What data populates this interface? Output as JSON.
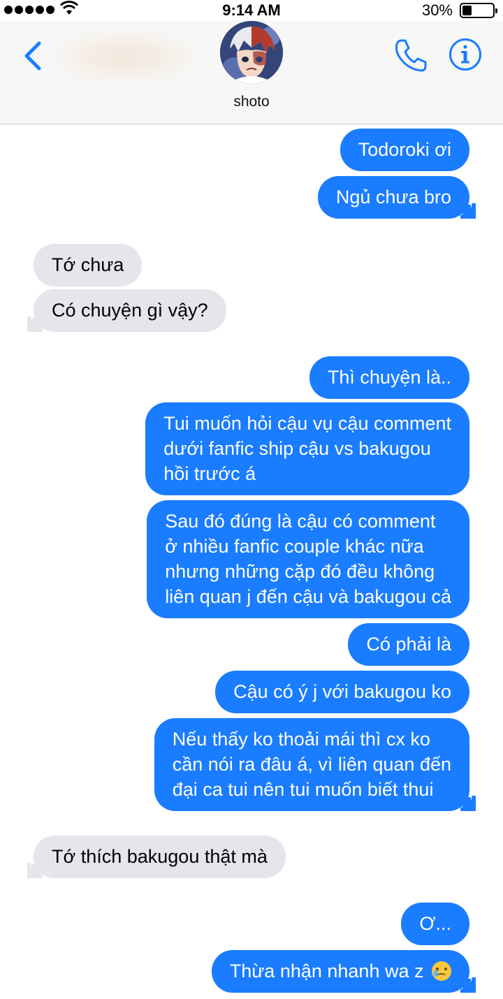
{
  "status_bar": {
    "time": "9:14 AM",
    "battery_percent": "30%",
    "battery_level": 0.3,
    "icons": [
      "signal-dots-icon",
      "wifi-icon",
      "battery-icon"
    ]
  },
  "header": {
    "contact_name": "shoto",
    "icons": [
      "back-chevron-icon",
      "phone-icon",
      "info-icon"
    ],
    "accent_color": "#1a7cff"
  },
  "messages": [
    {
      "direction": "outgoing",
      "lines": [
        "Todoroki ơi"
      ]
    },
    {
      "direction": "outgoing",
      "lines": [
        "Ngủ chưa bro"
      ]
    },
    {
      "direction": "incoming",
      "lines": [
        "Tớ chưa"
      ]
    },
    {
      "direction": "incoming",
      "lines": [
        "Có chuyện gì vậy?"
      ]
    },
    {
      "direction": "outgoing",
      "lines": [
        "Thì chuyện là.."
      ]
    },
    {
      "direction": "outgoing",
      "lines": [
        "Tui muốn hỏi cậu vụ cậu comment",
        "dưới fanfic ship cậu vs bakugou",
        "hồi trước á"
      ]
    },
    {
      "direction": "outgoing",
      "lines": [
        "Sau đó đúng là cậu có comment",
        "ở nhiều fanfic couple khác nữa",
        "nhưng những cặp đó đều không",
        "liên quan j đến cậu và bakugou cả"
      ]
    },
    {
      "direction": "outgoing",
      "lines": [
        "Có phải là"
      ]
    },
    {
      "direction": "outgoing",
      "lines": [
        "Cậu có ý j với bakugou ko"
      ]
    },
    {
      "direction": "outgoing",
      "lines": [
        "Nếu thấy ko thoải mái thì cx ko",
        "cần nói ra đâu á, vì liên quan đến",
        "đại ca tui nên tui muốn biết thui"
      ]
    },
    {
      "direction": "incoming",
      "lines": [
        "Tớ thích bakugou thật mà"
      ]
    },
    {
      "direction": "outgoing",
      "lines": [
        "Ơ..."
      ]
    },
    {
      "direction": "outgoing",
      "lines": [
        "Thừa nhận nhanh wa z"
      ],
      "emoji": "smiling-face-with-tear-icon"
    }
  ],
  "colors": {
    "outgoing_bubble": "#1a7cff",
    "incoming_bubble": "#e6e5eb"
  }
}
